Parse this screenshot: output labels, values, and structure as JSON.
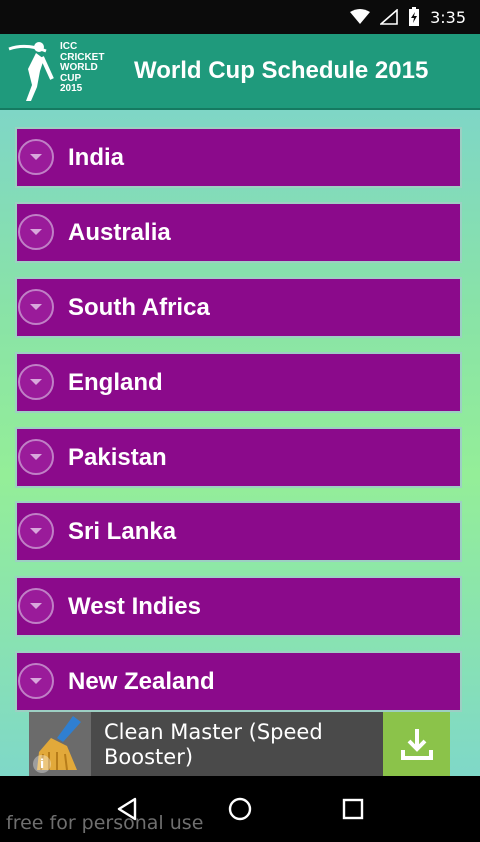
{
  "status_bar": {
    "time": "3:35",
    "icons": [
      "wifi-icon",
      "cell-signal-icon",
      "battery-charging-icon"
    ]
  },
  "app_bar": {
    "logo_lines": [
      "ICC",
      "CRICKET",
      "WORLD",
      "CUP",
      "2015"
    ],
    "title": "World Cup Schedule 2015"
  },
  "teams": [
    {
      "label": "India"
    },
    {
      "label": "Australia"
    },
    {
      "label": "South Africa"
    },
    {
      "label": "England"
    },
    {
      "label": "Pakistan"
    },
    {
      "label": "Sri Lanka"
    },
    {
      "label": "West Indies"
    },
    {
      "label": "New Zealand"
    }
  ],
  "ad": {
    "text": "Clean Master (Speed Booster)",
    "info_glyph": "i",
    "icons": [
      "broom-icon",
      "download-icon",
      "info-icon"
    ]
  },
  "nav": {
    "icons": [
      "back-icon",
      "home-icon",
      "recents-icon"
    ]
  },
  "watermark": "free for personal use",
  "colors": {
    "app_bar": "#1f9a7c",
    "group_bg": "#8b0a8b",
    "content_bg_mid": "#94ee98",
    "ad_download": "#8bc34a"
  }
}
